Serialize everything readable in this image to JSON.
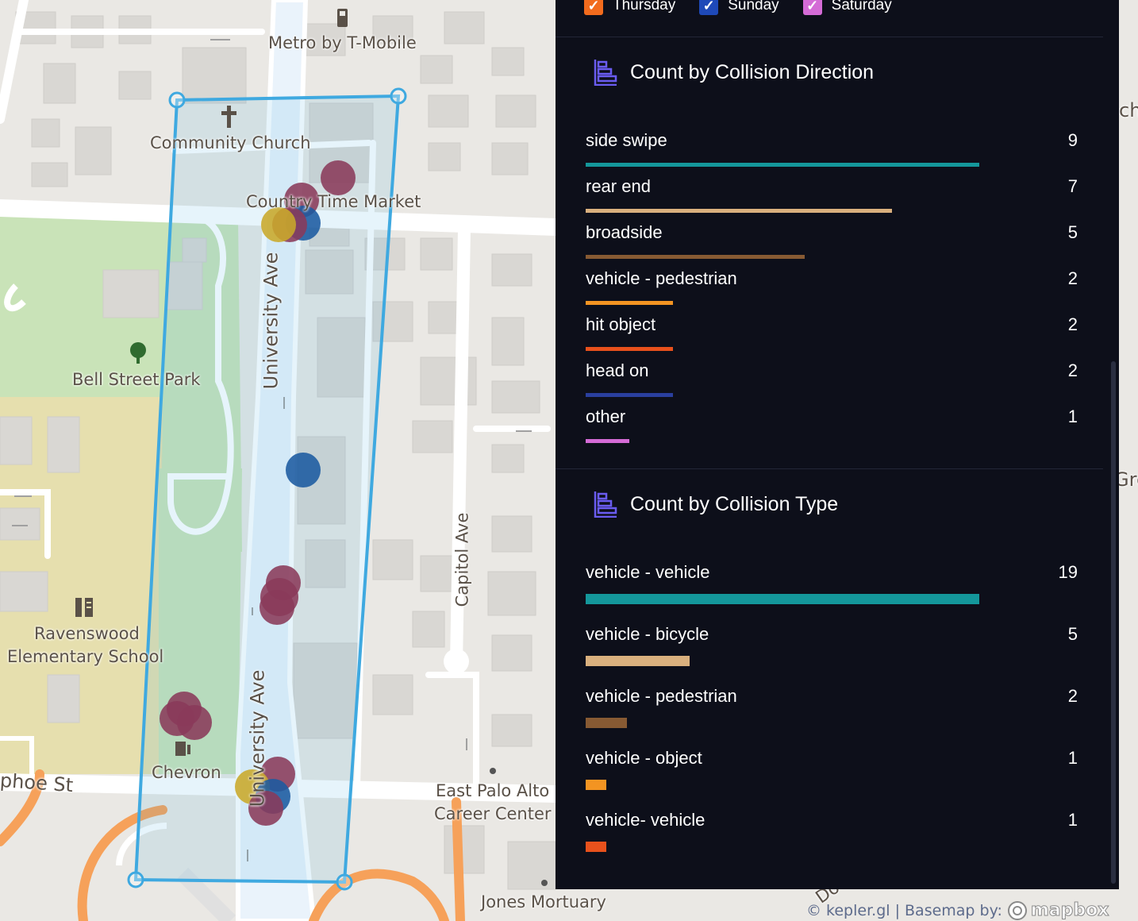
{
  "legend": {
    "items": [
      {
        "label": "Thursday",
        "color": "#f26b1d"
      },
      {
        "label": "Sunday",
        "color": "#1e49b8"
      },
      {
        "label": "Saturday",
        "color": "#d46bd6"
      }
    ]
  },
  "sections": [
    {
      "title": "Count by Collision Direction",
      "icon": "bar-chart-icon",
      "max": 9,
      "rows": [
        {
          "label": "side swipe",
          "value": 9,
          "color": "#14979b"
        },
        {
          "label": "rear end",
          "value": 7,
          "color": "#d9b07e"
        },
        {
          "label": "broadside",
          "value": 5,
          "color": "#875a33"
        },
        {
          "label": "vehicle - pedestrian",
          "value": 2,
          "color": "#f39422"
        },
        {
          "label": "hit object",
          "value": 2,
          "color": "#e8511c"
        },
        {
          "label": "head on",
          "value": 2,
          "color": "#2a3f9e"
        },
        {
          "label": "other",
          "value": 1,
          "color": "#d46bd6"
        }
      ]
    },
    {
      "title": "Count by Collision Type",
      "icon": "bar-chart-icon",
      "max": 19,
      "rows": [
        {
          "label": "vehicle - vehicle",
          "value": 19,
          "color": "#14979b"
        },
        {
          "label": "vehicle - bicycle",
          "value": 5,
          "color": "#d9b07e"
        },
        {
          "label": "vehicle - pedestrian",
          "value": 2,
          "color": "#875a33"
        },
        {
          "label": "vehicle - object",
          "value": 1,
          "color": "#f39422"
        },
        {
          "label": "vehicle- vehicle",
          "value": 1,
          "color": "#e8511c"
        }
      ]
    }
  ],
  "map": {
    "labels": {
      "metro": "Metro by T-Mobile",
      "community_church": "Community Church",
      "country_time_market": "Country Time Market",
      "university_ave_1": "University Ave",
      "university_ave_2": "University Ave",
      "bell_street_park": "Bell Street Park",
      "ravenswood": "Ravenswood",
      "elementary_school": "Elementary School",
      "chevron": "Chevron",
      "pope_st": "phoe St",
      "capitol_ave": "Capitol Ave",
      "east_palo_alto": "East Palo Alto",
      "career_center": "Career Center",
      "jones_mortuary": "Jones Mortuary",
      "edge_ch": "ch",
      "edge_gre": "Gre",
      "edge_do": "Do"
    },
    "selection_color": "#3fa9e0",
    "point_colors": {
      "maroon": "#8a3a5a",
      "blue": "#1b5aa0",
      "yellow": "#c9a92a"
    }
  },
  "attribution": {
    "kepler": "© kepler.gl | Basemap by:",
    "mapbox": "mapbox"
  }
}
